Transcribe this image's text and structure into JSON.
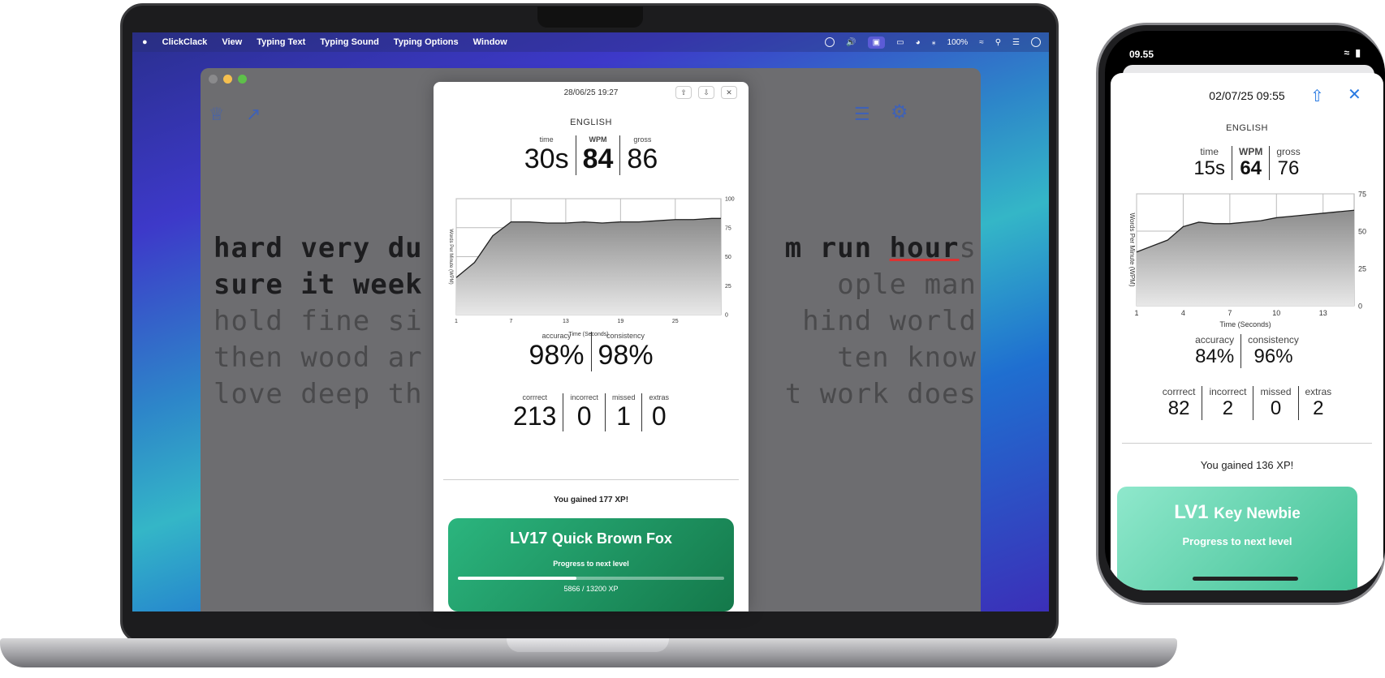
{
  "mac": {
    "menubar": {
      "app_name": "ClickClack",
      "items": [
        "View",
        "Typing Text",
        "Typing Sound",
        "Typing Options",
        "Window"
      ],
      "battery": "100%"
    },
    "typing": {
      "line1_typed": "hard very du",
      "line1_hidden_gap": "",
      "line1_right_typed": "m run ",
      "line1_err": "hour",
      "line1_next": "s",
      "line2_typed": "sure it week",
      "line2_right": "ople man",
      "line3_left": "hold fine si",
      "line3_right": "hind world",
      "line4_left": "then wood ar",
      "line4_right": "ten know",
      "line5_left": "love deep th",
      "line5_right": "t work does"
    },
    "result": {
      "timestamp": "28/06/25 19:27",
      "language": "ENGLISH",
      "time_label": "time",
      "time_value": "30s",
      "wpm_label": "WPM",
      "wpm_value": "84",
      "gross_label": "gross",
      "gross_value": "86",
      "accuracy_label": "accuracy",
      "accuracy_value": "98%",
      "consistency_label": "consistency",
      "consistency_value": "98%",
      "correct_label": "corrrect",
      "correct_value": "213",
      "incorrect_label": "incorrect",
      "incorrect_value": "0",
      "missed_label": "missed",
      "missed_value": "1",
      "extras_label": "extras",
      "extras_value": "0",
      "xp_text": "You gained 177 XP!",
      "level_num": "LV17",
      "level_name": "Quick Brown Fox",
      "progress_label": "Progress to next level",
      "progress_text": "5866 / 13200 XP",
      "progress_fraction": 0.444
    }
  },
  "phone": {
    "clock": "09.55",
    "result": {
      "timestamp": "02/07/25 09:55",
      "language": "ENGLISH",
      "time_label": "time",
      "time_value": "15s",
      "wpm_label": "WPM",
      "wpm_value": "64",
      "gross_label": "gross",
      "gross_value": "76",
      "accuracy_label": "accuracy",
      "accuracy_value": "84%",
      "consistency_label": "consistency",
      "consistency_value": "96%",
      "correct_label": "corrrect",
      "correct_value": "82",
      "incorrect_label": "incorrect",
      "incorrect_value": "2",
      "missed_label": "missed",
      "missed_value": "0",
      "extras_label": "extras",
      "extras_value": "2",
      "xp_text": "You gained 136 XP!",
      "level_num": "LV1",
      "level_name": "Key Newbie",
      "progress_label": "Progress to next level"
    }
  },
  "chart_data": [
    {
      "type": "area",
      "xlabel": "Time (Seconds)",
      "ylabel": "Words Per Minute (WPM)",
      "x_ticks": [
        1,
        7,
        13,
        19,
        25
      ],
      "y_ticks": [
        0,
        25,
        50,
        75,
        100
      ],
      "xlim": [
        1,
        30
      ],
      "ylim": [
        0,
        100
      ],
      "grid": true,
      "x": [
        1,
        3,
        5,
        7,
        9,
        11,
        13,
        15,
        17,
        19,
        21,
        23,
        25,
        27,
        29,
        30
      ],
      "values": [
        32,
        45,
        68,
        80,
        80,
        79,
        79,
        80,
        79,
        80,
        80,
        81,
        82,
        82,
        83,
        83
      ]
    },
    {
      "type": "area",
      "xlabel": "Time (Seconds)",
      "ylabel": "Words Per Minute (WPM)",
      "x_ticks": [
        1,
        4,
        7,
        10,
        13
      ],
      "y_ticks": [
        0,
        25,
        50,
        75
      ],
      "xlim": [
        1,
        15
      ],
      "ylim": [
        0,
        75
      ],
      "grid": true,
      "x": [
        1,
        2,
        3,
        4,
        5,
        6,
        7,
        8,
        9,
        10,
        11,
        12,
        13,
        14,
        15
      ],
      "values": [
        36,
        40,
        44,
        53,
        56,
        55,
        55,
        56,
        57,
        59,
        60,
        61,
        62,
        63,
        64
      ]
    }
  ]
}
